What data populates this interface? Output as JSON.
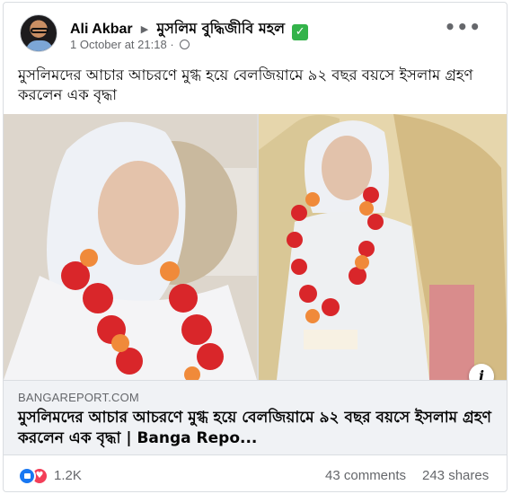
{
  "post": {
    "author": "Ali Akbar",
    "group": "মুসলিম বুদ্ধিজীবি মহল",
    "group_badge": "✓",
    "timestamp": "1 October at 21:18",
    "separator": "·",
    "privacy_icon": "globe-icon",
    "more_icon": "•••",
    "caption": "মুসলিমদের আচার আচরণে মুগ্ধ হয়ে বেলজিয়ামে ৯২ বছর বয়সে ইসলাম গ্রহণ করলেন এক বৃদ্ধা"
  },
  "link_preview": {
    "domain": "BANGAREPORT.COM",
    "title": "মুসলিমদের আচার আচরণে মুগ্ধ হয়ে বেলজিয়ামে ৯২ বছর বয়সে ইসলাম গ্রহণ করলেন এক বৃদ্ধা | Banga Repo...",
    "info_icon": "i"
  },
  "engagement": {
    "reactions": "1.2K",
    "comments": "43 comments",
    "shares": "243 shares",
    "reaction_icons": [
      "like-icon",
      "love-icon"
    ]
  },
  "colors": {
    "brand_blue": "#1877f2",
    "love_red": "#f33e58",
    "badge_green": "#33b34a",
    "secondary_text": "#65676b",
    "link_bg": "#f0f2f5"
  }
}
